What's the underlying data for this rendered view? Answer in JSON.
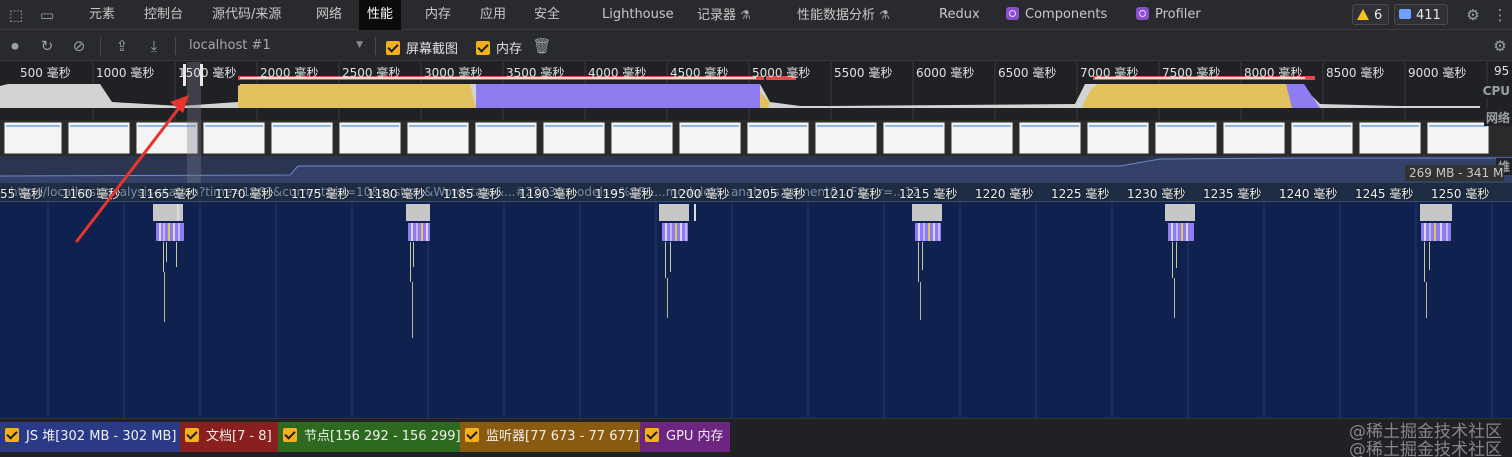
{
  "tabbar": {
    "tabs": [
      "元素",
      "控制台",
      "源代码/来源",
      "网络",
      "性能",
      "内存",
      "应用",
      "安全",
      "Lighthouse",
      "记录器",
      "性能数据分析",
      "Redux",
      "Components",
      "Profiler"
    ],
    "active_tab": "性能",
    "warnings_count": "6",
    "messages_count": "411"
  },
  "toolbar": {
    "profile_select": "localhost #1",
    "screenshots_label": "屏幕截图",
    "memory_label": "内存"
  },
  "overview": {
    "ticks": [
      "500 毫秒",
      "1000 毫秒",
      "1500 毫秒",
      "2000 毫秒",
      "2500 毫秒",
      "3000 毫秒",
      "3500 毫秒",
      "4000 毫秒",
      "4500 毫秒",
      "5000 毫秒",
      "5500 毫秒",
      "6000 毫秒",
      "6500 毫秒",
      "7000 毫秒",
      "7500 毫秒",
      "8000 毫秒",
      "8500 毫秒",
      "9000 毫秒",
      "95"
    ],
    "cpu_label": "CPU",
    "net_label": "网络",
    "heap_label": "堆",
    "heap_range": "269 MB - 341 MB"
  },
  "main": {
    "ruler_ticks": [
      "55 毫秒",
      "1160 毫秒",
      "1165 毫秒",
      "1170 毫秒",
      "1175 毫秒",
      "1180 毫秒",
      "1185 毫秒",
      "1190 毫秒",
      "1195 毫秒",
      "1200 毫秒",
      "1205 毫秒",
      "1210 毫秒",
      "1215 毫秒",
      "1220 毫秒",
      "1225 毫秒",
      "1230 毫秒",
      "1235 毫秒",
      "1240 毫秒",
      "1245 毫秒",
      "1250 毫秒"
    ],
    "ruler_url": "http://localhost/analysis-station?time=1263&current&id=10&system&Wordstate&...#2293&models=%2F&...moduleU...analysis...ement&...F&...r=...12"
  },
  "counters": [
    {
      "label": "JS 堆[302 MB - 302 MB]",
      "color": "#2a3a86"
    },
    {
      "label": "文档[7 - 8]",
      "color": "#8a1f1f"
    },
    {
      "label": "节点[156 292 - 156 299]",
      "color": "#2d6a1f"
    },
    {
      "label": "监听器[77 673 - 77 677]",
      "color": "#8a5a10"
    },
    {
      "label": "GPU 内存",
      "color": "#6d2582"
    }
  ],
  "watermark": [
    "@稀土掘金技术社区",
    "@稀土掘金技术社区"
  ],
  "colors": {
    "scripting": "#e2c25c",
    "rendering": "#8e7cf0",
    "idle": "#d0d0d0",
    "flame_bg": "#0f224f"
  }
}
